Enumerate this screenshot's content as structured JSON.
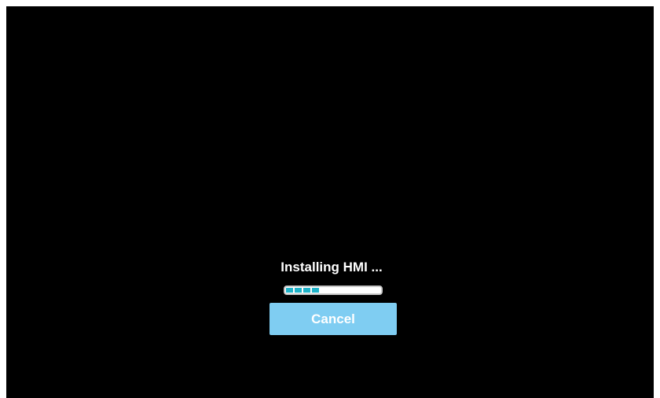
{
  "installer": {
    "status_text": "Installing HMI ...",
    "progress_fraction": 0.4,
    "progress_segments_filled": 4,
    "cancel_label": "Cancel"
  },
  "colors": {
    "background": "#000000",
    "progress_fill": "#1fb3c9",
    "progress_track": "#ffffff",
    "button": "#7fcdf2",
    "text": "#ffffff"
  }
}
